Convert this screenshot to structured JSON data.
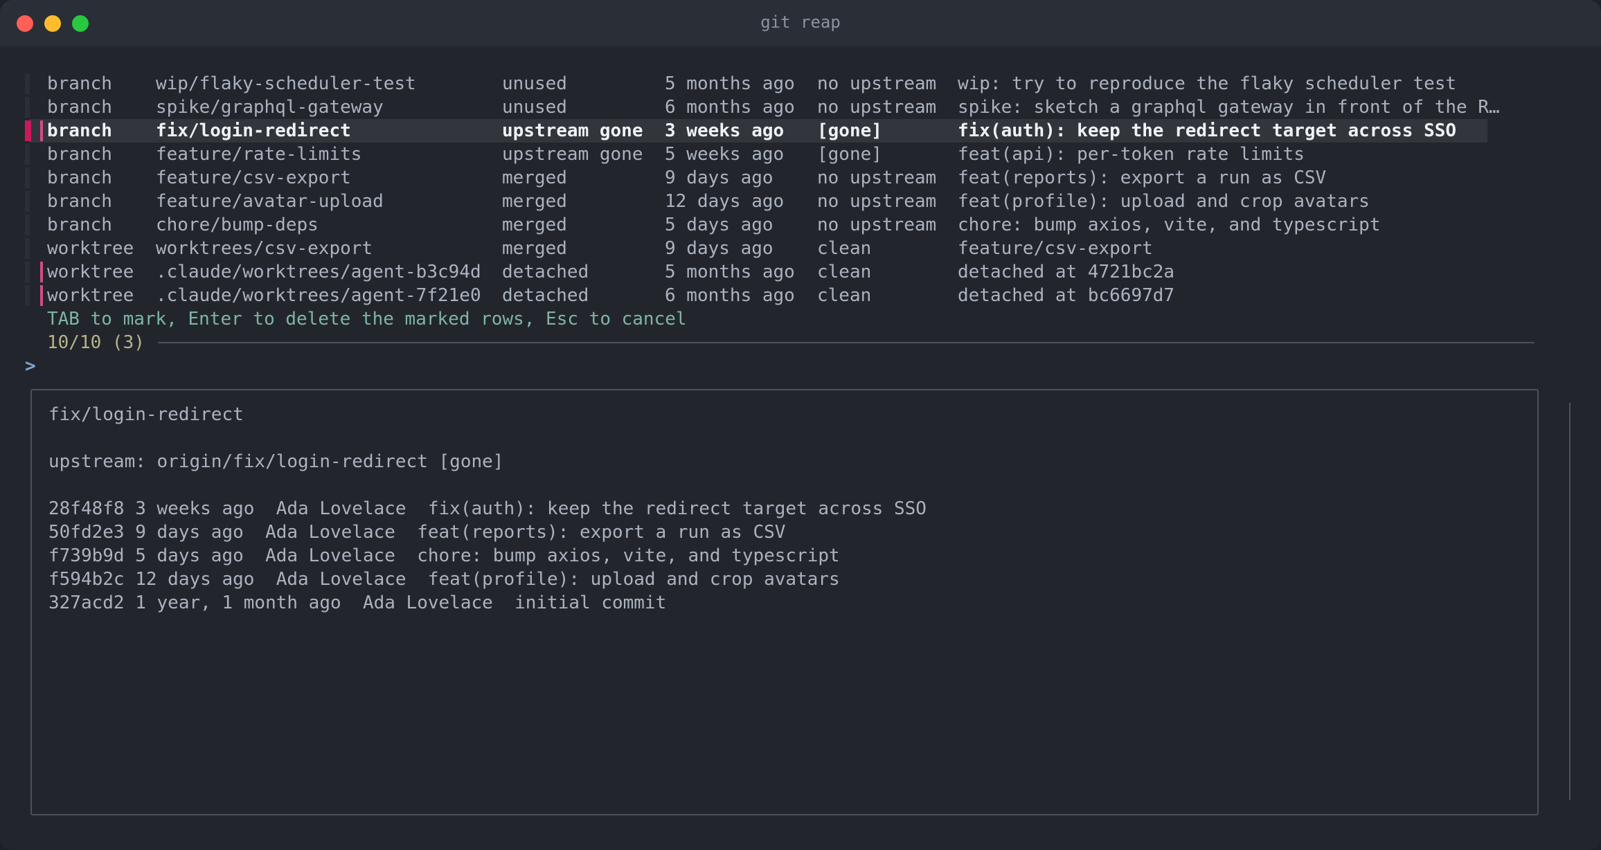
{
  "window": {
    "title": "git reap"
  },
  "rows": [
    {
      "kind": "branch",
      "name": "wip/flaky-scheduler-test",
      "state": "unused",
      "age": "5 months ago",
      "upstream": "no upstream",
      "message": "wip: try to reproduce the flaky scheduler test",
      "marked": false,
      "selected": false
    },
    {
      "kind": "branch",
      "name": "spike/graphql-gateway",
      "state": "unused",
      "age": "6 months ago",
      "upstream": "no upstream",
      "message": "spike: sketch a graphql gateway in front of the R…",
      "marked": false,
      "selected": false
    },
    {
      "kind": "branch",
      "name": "fix/login-redirect",
      "state": "upstream gone",
      "age": "3 weeks ago",
      "upstream": "[gone]",
      "message": "fix(auth): keep the redirect target across SSO",
      "marked": true,
      "selected": true
    },
    {
      "kind": "branch",
      "name": "feature/rate-limits",
      "state": "upstream gone",
      "age": "5 weeks ago",
      "upstream": "[gone]",
      "message": "feat(api): per-token rate limits",
      "marked": false,
      "selected": false
    },
    {
      "kind": "branch",
      "name": "feature/csv-export",
      "state": "merged",
      "age": "9 days ago",
      "upstream": "no upstream",
      "message": "feat(reports): export a run as CSV",
      "marked": false,
      "selected": false
    },
    {
      "kind": "branch",
      "name": "feature/avatar-upload",
      "state": "merged",
      "age": "12 days ago",
      "upstream": "no upstream",
      "message": "feat(profile): upload and crop avatars",
      "marked": false,
      "selected": false
    },
    {
      "kind": "branch",
      "name": "chore/bump-deps",
      "state": "merged",
      "age": "5 days ago",
      "upstream": "no upstream",
      "message": "chore: bump axios, vite, and typescript",
      "marked": false,
      "selected": false
    },
    {
      "kind": "worktree",
      "name": "worktrees/csv-export",
      "state": "merged",
      "age": "9 days ago",
      "upstream": "clean",
      "message": "feature/csv-export",
      "marked": false,
      "selected": false
    },
    {
      "kind": "worktree",
      "name": ".claude/worktrees/agent-b3c94d",
      "state": "detached",
      "age": "5 months ago",
      "upstream": "clean",
      "message": "detached at 4721bc2a",
      "marked": true,
      "selected": false
    },
    {
      "kind": "worktree",
      "name": ".claude/worktrees/agent-7f21e0",
      "state": "detached",
      "age": "6 months ago",
      "upstream": "clean",
      "message": "detached at bc6697d7",
      "marked": true,
      "selected": false
    }
  ],
  "hint": "TAB to mark, Enter to delete the marked rows, Esc to cancel",
  "counter": "10/10 (3)",
  "prompt": ">",
  "preview": {
    "lines": [
      "fix/login-redirect",
      "",
      "upstream: origin/fix/login-redirect [gone]",
      "",
      "28f48f8 3 weeks ago  Ada Lovelace  fix(auth): keep the redirect target across SSO",
      "50fd2e3 9 days ago  Ada Lovelace  feat(reports): export a run as CSV",
      "f739b9d 5 days ago  Ada Lovelace  chore: bump axios, vite, and typescript",
      "f594b2c 12 days ago  Ada Lovelace  feat(profile): upload and crop avatars",
      "327acd2 1 year, 1 month ago  Ada Lovelace  initial commit"
    ]
  }
}
